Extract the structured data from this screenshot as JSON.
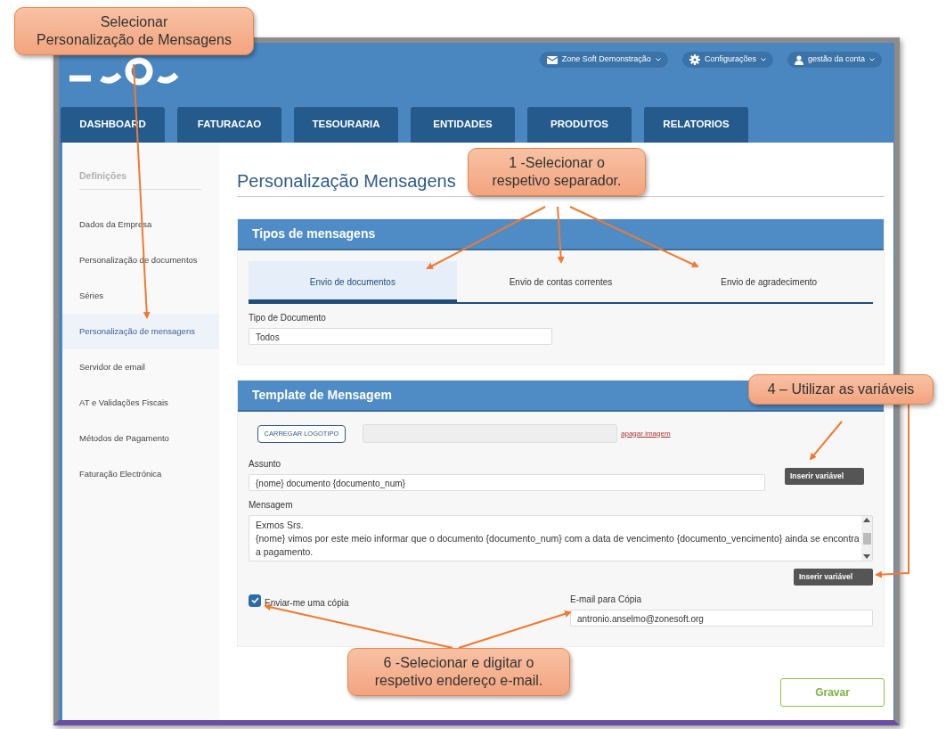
{
  "header": {
    "actions": [
      {
        "kind": "mail",
        "label": "Zone Soft Demonstração"
      },
      {
        "kind": "gear",
        "label": "Configurações"
      },
      {
        "kind": "user",
        "label": "gestão da conta"
      }
    ]
  },
  "nav_tabs": [
    "DASHBOARD",
    "FATURACAO",
    "TESOURARIA",
    "ENTIDADES",
    "PRODUTOS",
    "RELATORIOS"
  ],
  "sidebar": {
    "heading": "Definições",
    "items": [
      {
        "label": "Dados da Empresa",
        "selected": false
      },
      {
        "label": "Personalização de documentos",
        "selected": false
      },
      {
        "label": "Séries",
        "selected": false
      },
      {
        "label": "Personalização de mensagens",
        "selected": true
      },
      {
        "label": "Servidor de email",
        "selected": false
      },
      {
        "label": "AT e Validações Fiscais",
        "selected": false
      },
      {
        "label": "Métodos de Pagamento",
        "selected": false
      },
      {
        "label": "Faturação Electrónica",
        "selected": false
      }
    ]
  },
  "page_title": "Personalização Mensagens",
  "message_types": {
    "title": "Tipos de mensagens",
    "tabs": [
      {
        "label": "Envio de documentos",
        "selected": true
      },
      {
        "label": "Envio de contas correntes",
        "selected": false
      },
      {
        "label": "Envio de agradecimento",
        "selected": false
      }
    ],
    "document_type": {
      "label": "Tipo de Documento",
      "value": "Todos"
    }
  },
  "template": {
    "title": "Template de Mensagem",
    "upload_button": "CARREGAR LOGOTIPO",
    "delete_link": "apagar imagem",
    "subject": {
      "label": "Assunto",
      "value": "{nome} documento {documento_num}",
      "insert_button": "Inserir variável"
    },
    "message": {
      "label": "Mensagem",
      "value": "Exmos Srs.\n {nome} vimos por este meio informar que o documento  {documento_num} com a data de vencimento {documento_vencimento} ainda se encontra a pagamento.",
      "insert_button": "Inserir variável"
    },
    "send_copy": {
      "label": "Enviar-me uma cópia",
      "checked": true
    },
    "copy_email": {
      "label": "E-mail para Cópia",
      "value": "antronio.anselmo@zonesoft.org"
    }
  },
  "save_button": "Gravar",
  "callouts": [
    "Selecionar\nPersonalização de Mensagens",
    "1 -Selecionar o\nrespetivo separador.",
    "4 – Utilizar as variáveis",
    "6 -Selecionar e digitar o\nrespetivo endereço e-mail."
  ]
}
